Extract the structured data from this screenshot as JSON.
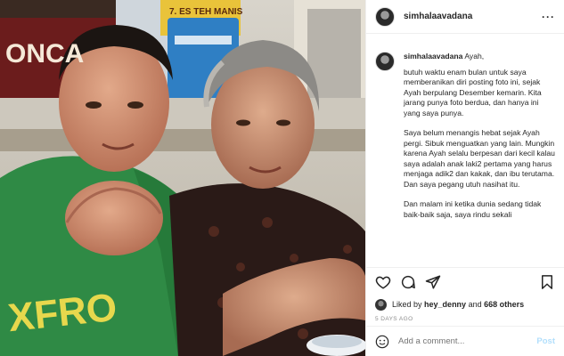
{
  "photo": {
    "sign_left": "ONCA",
    "sign_middle": "7. ES TEH MANIS",
    "shirt_text": "XFRO"
  },
  "header": {
    "username": "simhalaavadana",
    "more_label": "···"
  },
  "caption": {
    "username": "simhalaavadana",
    "opening": "Ayah,",
    "paragraphs": [
      "butuh waktu enam bulan untuk saya memberanikan diri posting foto ini, sejak Ayah berpulang Desember kemarin. Kita jarang punya foto berdua, dan hanya ini yang saya punya.",
      "Saya belum menangis hebat sejak Ayah pergi. Sibuk menguatkan yang lain. Mungkin karena Ayah selalu berpesan dari kecil kalau saya adalah anak laki2 pertama yang harus menjaga adik2 dan kakak, dan ibu terutama. Dan saya pegang utuh nasihat itu.",
      "Dan malam ini ketika dunia sedang tidak baik-baik saja, saya rindu sekali"
    ]
  },
  "likes": {
    "prefix": "Liked by",
    "user": "hey_denny",
    "conj": "and",
    "count": "668 others"
  },
  "date": "5 DAYS AGO",
  "comment": {
    "placeholder": "Add a comment...",
    "post_label": "Post"
  },
  "icons": {
    "like": "heart-icon",
    "comment": "comment-icon",
    "share": "share-icon",
    "save": "bookmark-icon",
    "emoji": "emoji-icon"
  },
  "colors": {
    "post_button": "#b2dffc",
    "muted_text": "#8e8e8e",
    "text": "#262626"
  }
}
